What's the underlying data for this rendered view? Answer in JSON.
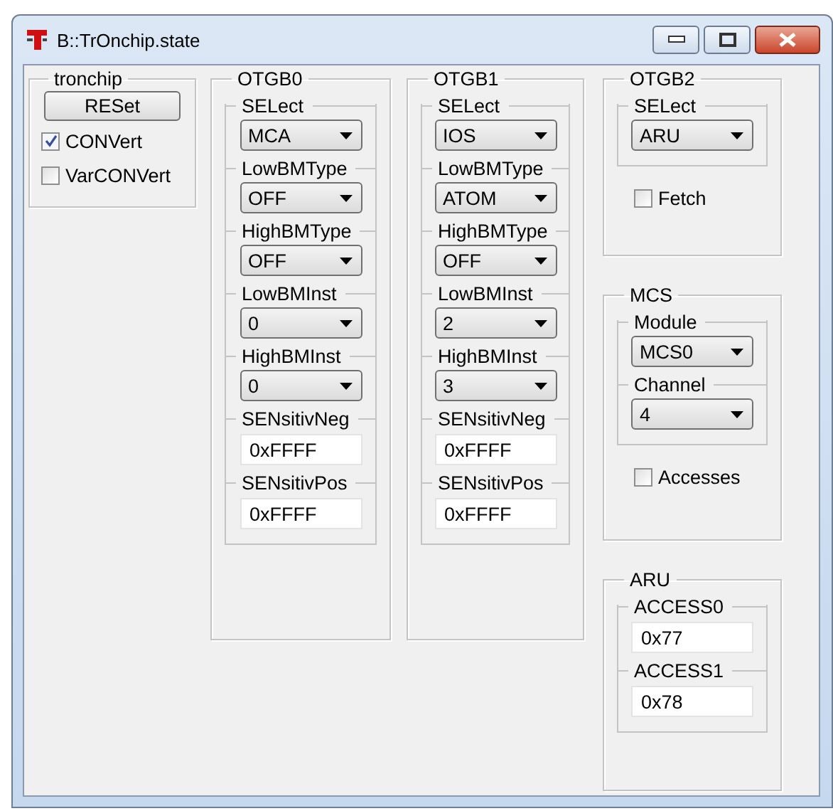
{
  "window": {
    "title": "B::TrOnchip.state"
  },
  "columns": [
    [
      {
        "title": "tronchip",
        "items": [
          {
            "kind": "button",
            "label": "RESet"
          },
          {
            "kind": "checkbox",
            "label": "CONVert",
            "checked": true
          },
          {
            "kind": "checkbox",
            "label": "VarCONVert",
            "checked": false
          }
        ]
      }
    ],
    [
      {
        "title": "OTGB0",
        "items": [
          {
            "kind": "section",
            "rows": [
              {
                "kind": "combo",
                "label": "SELect",
                "value": "MCA"
              },
              {
                "kind": "combo",
                "label": "LowBMType",
                "value": "OFF"
              },
              {
                "kind": "combo",
                "label": "HighBMType",
                "value": "OFF"
              },
              {
                "kind": "combo",
                "label": "LowBMInst",
                "value": "0"
              },
              {
                "kind": "combo",
                "label": "HighBMInst",
                "value": "0"
              },
              {
                "kind": "text",
                "label": "SENsitivNeg",
                "value": "0xFFFF"
              },
              {
                "kind": "text",
                "label": "SENsitivPos",
                "value": "0xFFFF"
              }
            ]
          }
        ]
      }
    ],
    [
      {
        "title": "OTGB1",
        "items": [
          {
            "kind": "section",
            "rows": [
              {
                "kind": "combo",
                "label": "SELect",
                "value": "IOS"
              },
              {
                "kind": "combo",
                "label": "LowBMType",
                "value": "ATOM"
              },
              {
                "kind": "combo",
                "label": "HighBMType",
                "value": "OFF"
              },
              {
                "kind": "combo",
                "label": "LowBMInst",
                "value": "2"
              },
              {
                "kind": "combo",
                "label": "HighBMInst",
                "value": "3"
              },
              {
                "kind": "text",
                "label": "SENsitivNeg",
                "value": "0xFFFF"
              },
              {
                "kind": "text",
                "label": "SENsitivPos",
                "value": "0xFFFF"
              }
            ]
          }
        ]
      }
    ],
    [
      {
        "title": "OTGB2",
        "items": [
          {
            "kind": "section",
            "rows": [
              {
                "kind": "combo",
                "label": "SELect",
                "value": "ARU"
              }
            ]
          },
          {
            "kind": "checkbox",
            "label": "Fetch",
            "checked": false
          }
        ]
      },
      {
        "title": "MCS",
        "items": [
          {
            "kind": "section",
            "rows": [
              {
                "kind": "combo",
                "label": "Module",
                "value": "MCS0"
              },
              {
                "kind": "combo",
                "label": "Channel",
                "value": "4"
              }
            ]
          },
          {
            "kind": "checkbox",
            "label": "Accesses",
            "checked": false
          }
        ]
      },
      {
        "title": "ARU",
        "items": [
          {
            "kind": "section",
            "rows": [
              {
                "kind": "text",
                "label": "ACCESS0",
                "value": "0x77"
              },
              {
                "kind": "text",
                "label": "ACCESS1",
                "value": "0x78"
              }
            ]
          }
        ]
      }
    ]
  ]
}
